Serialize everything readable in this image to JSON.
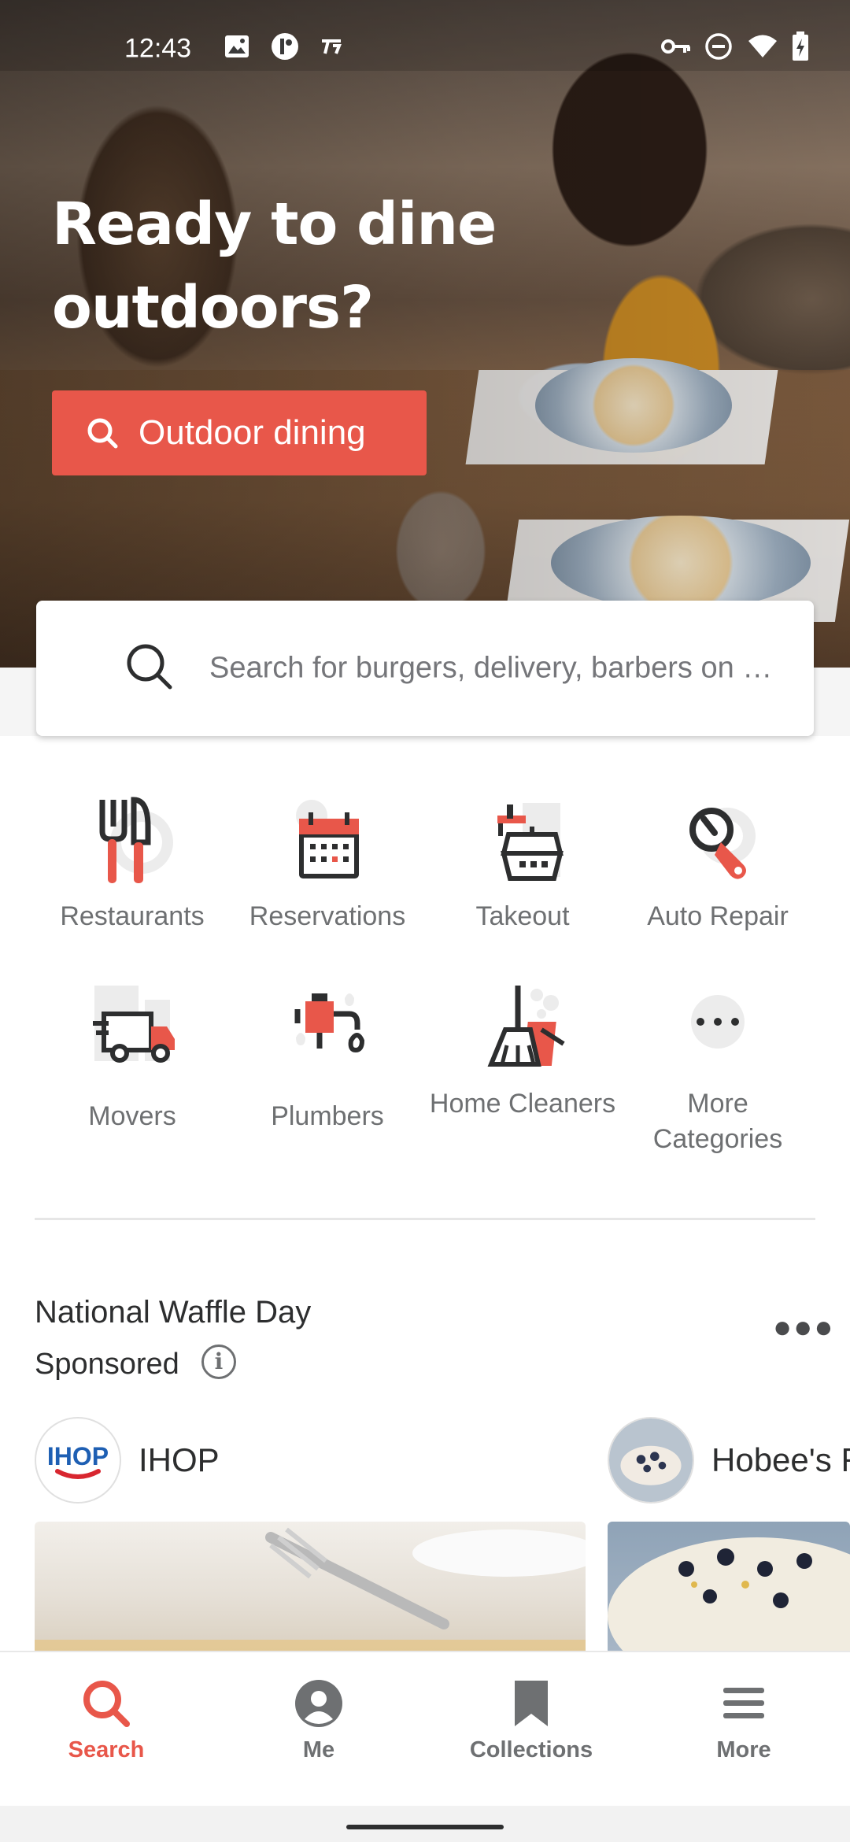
{
  "status_bar": {
    "time": "12:43"
  },
  "hero": {
    "title": "Ready to dine outdoors?",
    "cta_label": "Outdoor dining"
  },
  "search": {
    "placeholder": "Search for burgers, delivery, barbers on …"
  },
  "categories": [
    {
      "label": "Restaurants",
      "icon": "fork-knife-icon"
    },
    {
      "label": "Reservations",
      "icon": "calendar-icon"
    },
    {
      "label": "Takeout",
      "icon": "takeout-box-icon"
    },
    {
      "label": "Auto Repair",
      "icon": "wrench-icon"
    },
    {
      "label": "Movers",
      "icon": "moving-truck-icon"
    },
    {
      "label": "Plumbers",
      "icon": "faucet-icon"
    },
    {
      "label": "Home Cleaners",
      "icon": "broom-icon"
    },
    {
      "label": "More Categories",
      "icon": "more-dots-icon"
    }
  ],
  "promo_section": {
    "title": "National Waffle Day",
    "subtitle": "Sponsored",
    "businesses": [
      {
        "name": "IHOP",
        "logo_text": "IHOP"
      },
      {
        "name": "Hobee's R"
      }
    ]
  },
  "bottom_nav": [
    {
      "label": "Search",
      "icon": "search-icon",
      "active": true
    },
    {
      "label": "Me",
      "icon": "profile-icon",
      "active": false
    },
    {
      "label": "Collections",
      "icon": "bookmark-icon",
      "active": false
    },
    {
      "label": "More",
      "icon": "menu-icon",
      "active": false
    }
  ],
  "colors": {
    "accent": "#e8574a",
    "dark": "#2d2e2f",
    "muted": "#6e7072"
  }
}
